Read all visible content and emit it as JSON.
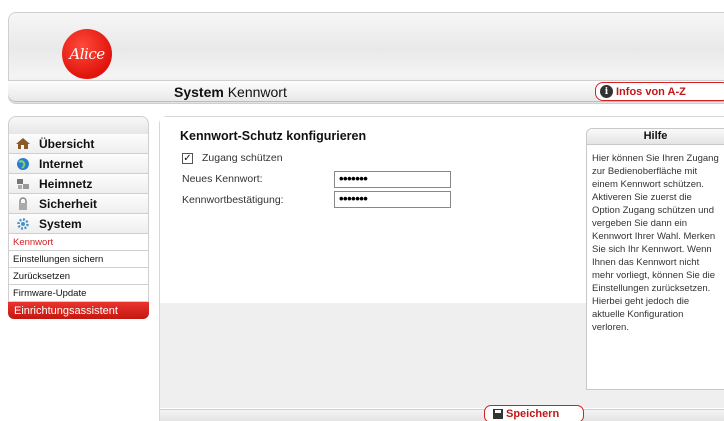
{
  "brand": {
    "logo_text": "Alice",
    "accent_color": "#d42020"
  },
  "header": {
    "page_title_bold": "System",
    "page_title_rest": "Kennwort",
    "infos_label": "Infos von A-Z",
    "infos_icon": "info-icon"
  },
  "sidebar": {
    "items": [
      {
        "label": "Übersicht",
        "icon": "house-icon"
      },
      {
        "label": "Internet",
        "icon": "globe-icon"
      },
      {
        "label": "Heimnetz",
        "icon": "network-icon"
      },
      {
        "label": "Sicherheit",
        "icon": "lock-icon"
      },
      {
        "label": "System",
        "icon": "gear-icon"
      }
    ],
    "subitems": [
      {
        "label": "Kennwort",
        "active": true
      },
      {
        "label": "Einstellungen sichern",
        "active": false
      },
      {
        "label": "Zurücksetzen",
        "active": false
      },
      {
        "label": "Firmware-Update",
        "active": false
      }
    ],
    "wizard_label": "Einrichtungsassistent"
  },
  "form": {
    "title": "Kennwort-Schutz konfigurieren",
    "protect_label": "Zugang schützen",
    "protect_checked": true,
    "new_password_label": "Neues Kennwort:",
    "new_password_value": "•••••••",
    "confirm_label": "Kennwortbestätigung:",
    "confirm_value": "•••••••",
    "save_label": "Speichern"
  },
  "help": {
    "title": "Hilfe",
    "text": "Hier können Sie Ihren Zugang zur Bedienoberfläche mit einem Kennwort schützen. Aktiveren Sie zuerst die Option Zugang schützen und vergeben Sie dann ein Kennwort Ihrer Wahl. Merken Sie sich Ihr Kennwort. Wenn Ihnen das Kennwort nicht mehr vorliegt, können Sie die Einstellungen zurücksetzen. Hierbei geht jedoch die aktuelle Konfiguration verloren."
  }
}
